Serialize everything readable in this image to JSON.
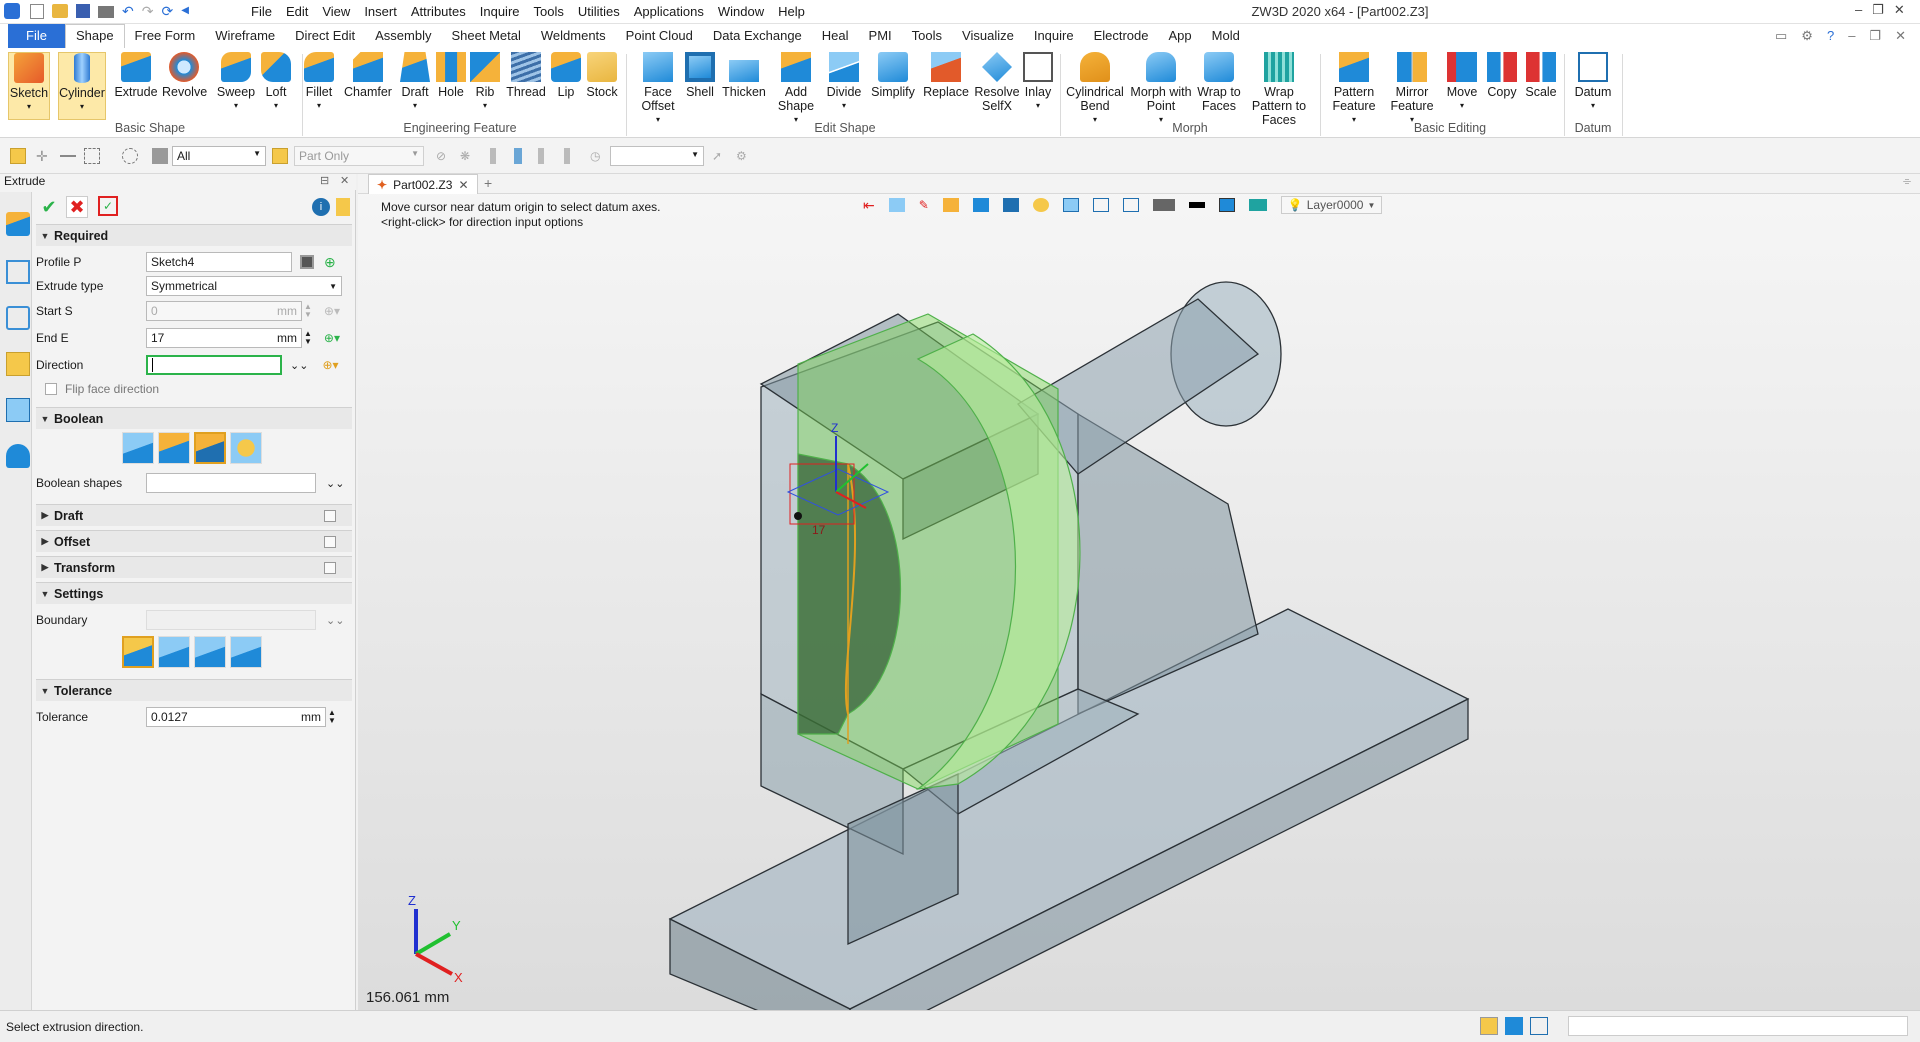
{
  "app": {
    "title": "ZW3D 2020 x64 - [Part002.Z3]"
  },
  "menu": [
    "File",
    "Edit",
    "View",
    "Insert",
    "Attributes",
    "Inquire",
    "Tools",
    "Utilities",
    "Applications",
    "Window",
    "Help"
  ],
  "ribbon_tabs": [
    "File",
    "Shape",
    "Free Form",
    "Wireframe",
    "Direct Edit",
    "Assembly",
    "Sheet Metal",
    "Weldments",
    "Point Cloud",
    "Data Exchange",
    "Heal",
    "PMI",
    "Tools",
    "Visualize",
    "Inquire",
    "Electrode",
    "App",
    "Mold"
  ],
  "ribbon": {
    "basic_shape": {
      "title": "Basic Shape",
      "items": [
        "Sketch",
        "Cylinder",
        "Extrude",
        "Revolve",
        "Sweep",
        "Loft"
      ]
    },
    "engineering_feature": {
      "title": "Engineering Feature",
      "items": [
        "Fillet",
        "Chamfer",
        "Draft",
        "Hole",
        "Rib",
        "Thread",
        "Lip",
        "Stock"
      ]
    },
    "edit_shape": {
      "title": "Edit Shape",
      "items": [
        "Face Offset",
        "Shell",
        "Thicken",
        "Add Shape",
        "Divide",
        "Simplify",
        "Replace",
        "Resolve SelfX",
        "Inlay"
      ]
    },
    "morph": {
      "title": "Morph",
      "items": [
        "Cylindrical Bend",
        "Morph with Point",
        "Wrap to Faces",
        "Wrap Pattern to Faces"
      ]
    },
    "basic_editing": {
      "title": "Basic Editing",
      "items": [
        "Pattern Feature",
        "Mirror Feature",
        "Move",
        "Copy",
        "Scale"
      ]
    },
    "datum": {
      "title": "Datum",
      "items": [
        "Datum"
      ]
    }
  },
  "quickbar": {
    "filter": "All",
    "scope": "Part Only",
    "extra": ""
  },
  "panel": {
    "title": "Extrude",
    "required": "Required",
    "profile_label": "Profile P",
    "profile_value": "Sketch4",
    "type_label": "Extrude type",
    "type_value": "Symmetrical",
    "start_label": "Start S",
    "start_value": "0",
    "start_unit": "mm",
    "end_label": "End E",
    "end_value": "17",
    "end_unit": "mm",
    "direction_label": "Direction",
    "direction_value": "",
    "flip_label": "Flip face direction",
    "boolean": "Boolean",
    "boolean_shapes_label": "Boolean shapes",
    "boolean_shapes_value": "",
    "draft": "Draft",
    "offset": "Offset",
    "transform": "Transform",
    "settings": "Settings",
    "boundary_label": "Boundary",
    "boundary_value": "",
    "tolerance_section": "Tolerance",
    "tolerance_label": "Tolerance",
    "tolerance_value": "0.0127",
    "tolerance_unit": "mm"
  },
  "doc_tab": "Part002.Z3",
  "viewport": {
    "hint1": "Move cursor near datum origin to select datum axes.",
    "hint2": "<right-click> for direction input options",
    "layer": "Layer0000",
    "dimension_label": "17",
    "scale_readout": "156.061 mm",
    "triad": {
      "x": "X",
      "y": "Y",
      "z": "Z"
    }
  },
  "status": "Select extrusion direction.",
  "colors": {
    "accent": "#2a6fd6",
    "selection_green": "#7ed957",
    "model_gray": "#8fa1ad"
  }
}
